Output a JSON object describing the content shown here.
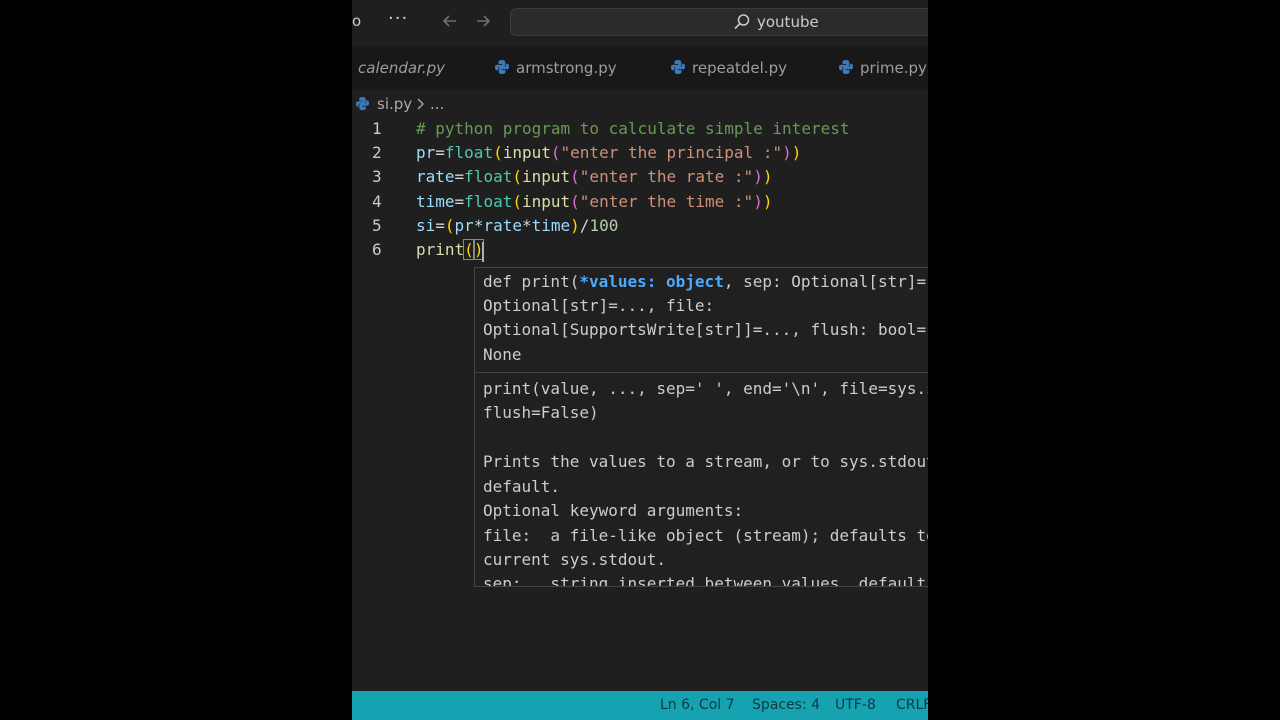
{
  "titlebar": {
    "menu_fragment": "o",
    "more_label": "···",
    "search_text": "youtube"
  },
  "tabs": [
    {
      "label": "calendar.py",
      "active": false
    },
    {
      "label": "armstrong.py",
      "active": false
    },
    {
      "label": "repeatdel.py",
      "active": false
    },
    {
      "label": "prime.py",
      "active": false
    }
  ],
  "breadcrumb": {
    "file": "si.py",
    "more": "..."
  },
  "editor": {
    "line_numbers": [
      "1",
      "2",
      "3",
      "4",
      "5",
      "6"
    ],
    "lines": [
      [
        {
          "t": "# python program to calculate simple interest",
          "c": "comment"
        }
      ],
      [
        {
          "t": "pr",
          "c": "var"
        },
        {
          "t": "=",
          "c": "op"
        },
        {
          "t": "float",
          "c": "cls"
        },
        {
          "t": "(",
          "c": "br1"
        },
        {
          "t": "input",
          "c": "fn"
        },
        {
          "t": "(",
          "c": "br2"
        },
        {
          "t": "\"enter the principal :\"",
          "c": "str"
        },
        {
          "t": ")",
          "c": "br2"
        },
        {
          "t": ")",
          "c": "br1"
        }
      ],
      [
        {
          "t": "rate",
          "c": "var"
        },
        {
          "t": "=",
          "c": "op"
        },
        {
          "t": "float",
          "c": "cls"
        },
        {
          "t": "(",
          "c": "br1"
        },
        {
          "t": "input",
          "c": "fn"
        },
        {
          "t": "(",
          "c": "br2"
        },
        {
          "t": "\"enter the rate :\"",
          "c": "str"
        },
        {
          "t": ")",
          "c": "br2"
        },
        {
          "t": ")",
          "c": "br1"
        }
      ],
      [
        {
          "t": "time",
          "c": "var"
        },
        {
          "t": "=",
          "c": "op"
        },
        {
          "t": "float",
          "c": "cls"
        },
        {
          "t": "(",
          "c": "br1"
        },
        {
          "t": "input",
          "c": "fn"
        },
        {
          "t": "(",
          "c": "br2"
        },
        {
          "t": "\"enter the time :\"",
          "c": "str"
        },
        {
          "t": ")",
          "c": "br2"
        },
        {
          "t": ")",
          "c": "br1"
        }
      ],
      [
        {
          "t": "si",
          "c": "var"
        },
        {
          "t": "=",
          "c": "op"
        },
        {
          "t": "(",
          "c": "br1"
        },
        {
          "t": "pr",
          "c": "var"
        },
        {
          "t": "*",
          "c": "op"
        },
        {
          "t": "rate",
          "c": "var"
        },
        {
          "t": "*",
          "c": "op"
        },
        {
          "t": "time",
          "c": "var"
        },
        {
          "t": ")",
          "c": "br1"
        },
        {
          "t": "/",
          "c": "op"
        },
        {
          "t": "100",
          "c": "num"
        }
      ],
      [
        {
          "t": "print",
          "c": "fn"
        },
        {
          "t": "(",
          "c": "br1"
        },
        {
          "t": ")",
          "c": "br1"
        }
      ]
    ]
  },
  "hover": {
    "signature": {
      "l1_pre": "def print(",
      "l1_param": "*values: object",
      "l1_post": ", sep: Optional[str]=...,",
      "l2": "Optional[str]=..., file:",
      "l3": "Optional[SupportsWrite[str]]=..., flush: bool=...) ->",
      "l4": "None"
    },
    "doc": [
      "print(value, ..., sep=' ', end='\\n', file=sys.stdout,",
      "flush=False)",
      "",
      "Prints the values to a stream, or to sys.stdout by",
      "default.",
      "Optional keyword arguments:",
      "file:  a file-like object (stream); defaults to the",
      "current sys.stdout.",
      "sep:   string inserted between values, default a space."
    ]
  },
  "statusbar": {
    "position": "Ln 6, Col 7",
    "spaces": "Spaces: 4",
    "encoding": "UTF-8",
    "eol": "CRLF"
  },
  "colors": {
    "accent_statusbar": "#16a2b0",
    "editor_bg": "#1f1f1f",
    "active_param": "#4daafc"
  }
}
